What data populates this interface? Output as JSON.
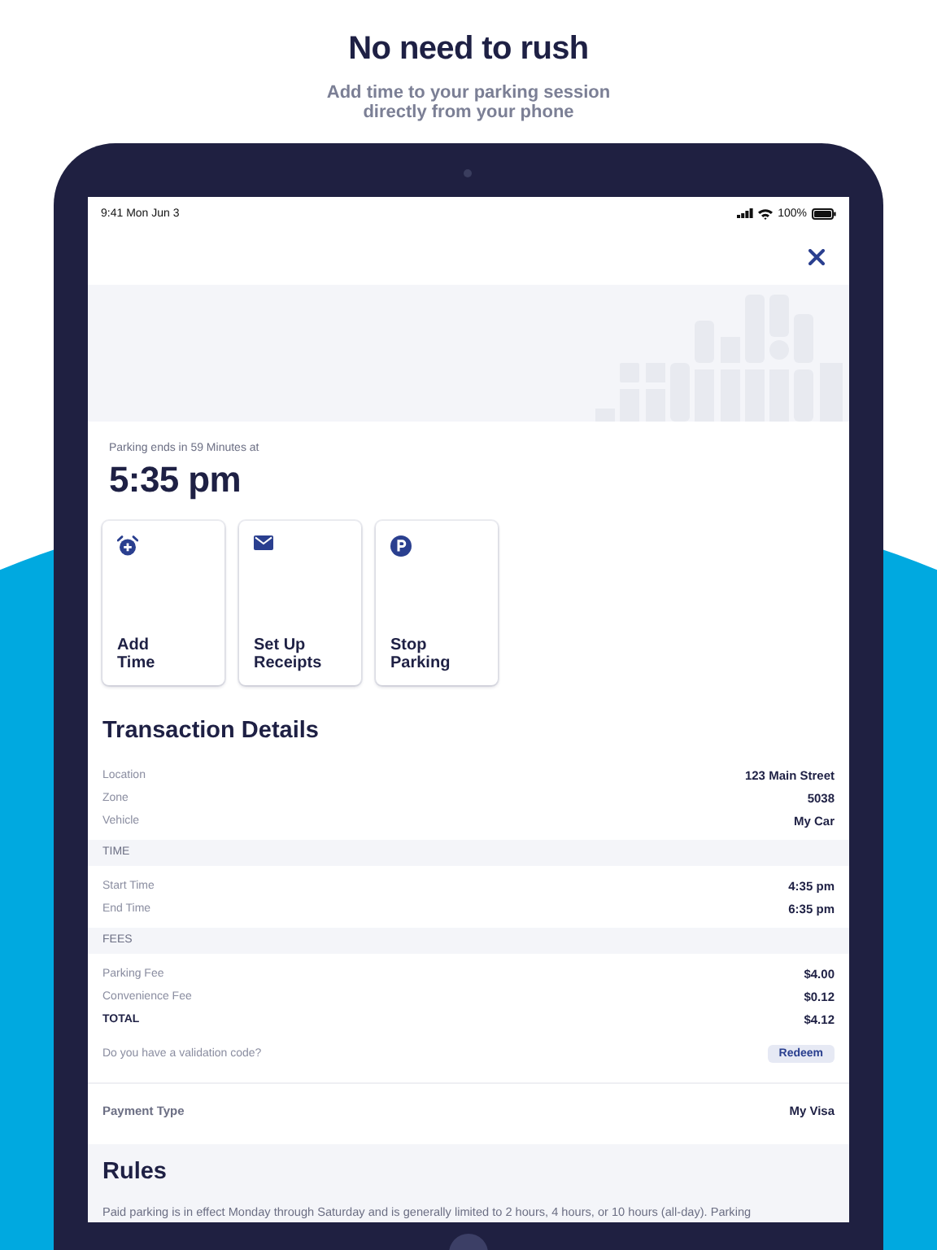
{
  "header": {
    "title": "No need to rush",
    "subtitle": "Add time to your parking session\ndirectly from your phone"
  },
  "status_bar": {
    "time": "9:41  Mon Jun 3",
    "battery": "100%"
  },
  "session": {
    "caption": "Parking ends in 59 Minutes at",
    "end_time": "5:35 pm"
  },
  "actions": [
    {
      "kind": "alarm",
      "label": "Add\nTime"
    },
    {
      "kind": "mail",
      "label": "Set Up\nReceipts"
    },
    {
      "kind": "parking",
      "label": "Stop\nParking"
    }
  ],
  "transaction": {
    "title": "Transaction Details",
    "rows": [
      {
        "kind": "field",
        "label": "Location",
        "value": "123 Main Street"
      },
      {
        "kind": "field",
        "label": "Zone",
        "value": "5038"
      },
      {
        "kind": "field",
        "label": "Vehicle",
        "value": "My Car"
      },
      {
        "kind": "header",
        "label": "TIME"
      },
      {
        "kind": "field",
        "label": "Start Time",
        "value": "4:35 pm"
      },
      {
        "kind": "field",
        "label": "End Time",
        "value": "6:35 pm"
      },
      {
        "kind": "header",
        "label": "FEES"
      },
      {
        "kind": "field",
        "label": "Parking Fee",
        "value": "$4.00"
      },
      {
        "kind": "field",
        "label": "Convenience Fee",
        "value": "$0.12"
      },
      {
        "kind": "total",
        "label": "TOTAL",
        "value": "$4.12"
      },
      {
        "kind": "prompt",
        "label": "Do you have a validation code?",
        "button": "Redeem"
      }
    ]
  },
  "payment": {
    "label": "Payment Type",
    "value": "My Visa"
  },
  "rules": {
    "title": "Rules",
    "text": "Paid parking is in effect Monday through Saturday and is generally limited to 2 hours, 4 hours, or 10 hours (all-day). Parking"
  }
}
